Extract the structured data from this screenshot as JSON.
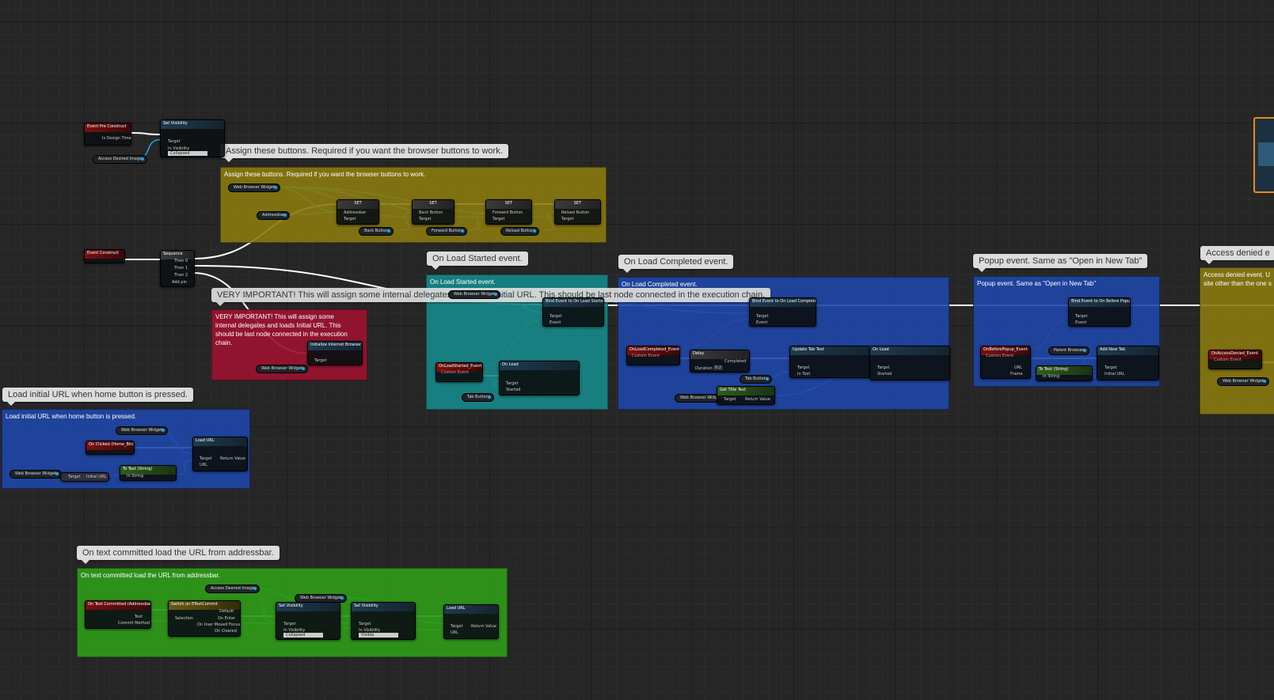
{
  "comments": {
    "buttons": "Assign these buttons. Required if you want the browser buttons to work.",
    "load_started": "On Load Started event.",
    "load_completed": "On Load Completed event.",
    "popup": "Popup event. Same as \"Open in New Tab\"",
    "access_denied": "Access denied e",
    "access_denied_body": "Access denied event. U",
    "access_denied_body2": "site other than the one s",
    "important": "VERY IMPORTANT! This will assign some internal delegates and loads Initial URL. This should be last node connected in the execution chain.",
    "important_body": "VERY IMPORTANT! This will assign some internal delegates and loads Initial URL. This should be last node connected in the execution chain.",
    "home": "Load initial URL when home button is pressed.",
    "text_committed": "On text committed load the URL from addressbar."
  },
  "nodes": {
    "pre_construct": {
      "title": "Event Pre Construct",
      "pin": "Is Design Time"
    },
    "set_visibility_1": {
      "title": "Set Visibility",
      "target": "Target",
      "in_visibility": "In Visibility",
      "value": "Collapsed"
    },
    "access_desired_image": "Access Desired Image",
    "event_construct": {
      "title": "Event Construct"
    },
    "sequence": {
      "title": "Sequence",
      "then0": "Then 0",
      "then1": "Then 1",
      "then2": "Then 2",
      "add_pin": "Add pin"
    },
    "web_browser_widget": "Web Browser Widget",
    "addressbar": "Addressbar",
    "set": "SET",
    "addressbar_pin": "Addressbar",
    "target": "Target",
    "back_button": "Back Button",
    "forward_button": "Forward Button",
    "reload_button": "Reload Button",
    "initialize": {
      "title": "Initialize Internet Browser"
    },
    "bind_load_started": {
      "title": "Bind Event to On Load Started",
      "event": "Event"
    },
    "on_load_started": {
      "title": "OnLoadStarted_Event",
      "sub": "Custom Event"
    },
    "on_load": {
      "title": "On Load",
      "started": "Started"
    },
    "tab_button": "Tab Button",
    "bind_load_completed": {
      "title": "Bind Event to On Load Completed"
    },
    "on_load_completed": {
      "title": "OnLoadCompleted_Event",
      "sub": "Custom Event"
    },
    "delay": {
      "title": "Delay",
      "completed": "Completed",
      "duration": "Duration",
      "duration_value": "0.2"
    },
    "update_tab_text": {
      "title": "Update Tab Text",
      "in_text": "In Text"
    },
    "on_load_2": {
      "title": "On Load"
    },
    "get_title_text": {
      "title": "Get Title Text",
      "return_value": "Return Value"
    },
    "bind_before_popup": {
      "title": "Bind Event to On Before Popup"
    },
    "on_before_popup": {
      "title": "OnBeforePopup_Event",
      "sub": "Custom Event",
      "url": "URL",
      "frame": "Frame"
    },
    "parent_browser": "Parent Browser",
    "add_new_tab": {
      "title": "Add New Tab",
      "initial_url": "Initial URL"
    },
    "to_text_1": {
      "title": "To Text (String)",
      "in_string": "In String"
    },
    "on_access_denied": {
      "title": "OnAccessDenied_Event",
      "sub": "Custom Event"
    },
    "on_clicked": {
      "title": "On Clicked (Home_Btn)"
    },
    "load_url": {
      "title": "Load URL",
      "url": "URL"
    },
    "initial_url": "Initial URL",
    "on_text_committed": {
      "title": "On Text Committed (Addressbar)",
      "text": "Text",
      "commit_method": "Commit Method"
    },
    "switch": {
      "title": "Switch on ETextCommit",
      "default": "Default",
      "selection": "Selection",
      "on_enter": "On Enter",
      "on_user_moved_focus": "On User Moved Focus",
      "on_cleared": "On Cleared"
    },
    "set_visibility_2": {
      "title": "Set Visibility",
      "value": "Collapsed"
    },
    "set_visibility_3": {
      "title": "Set Visibility",
      "value": "Visible"
    }
  },
  "colors": {
    "buttons_comment": "#8a7a10",
    "load_started_comment": "#168a8a",
    "load_completed_comment": "#1f47a8",
    "popup_comment": "#1f47a8",
    "access_denied_comment": "#8a7a10",
    "important_comment": "#9a1230",
    "home_comment": "#1f47a8",
    "text_committed_comment": "#2e9a18",
    "exec_wire": "#ffffff",
    "object_wire": "#1ea7e8"
  }
}
